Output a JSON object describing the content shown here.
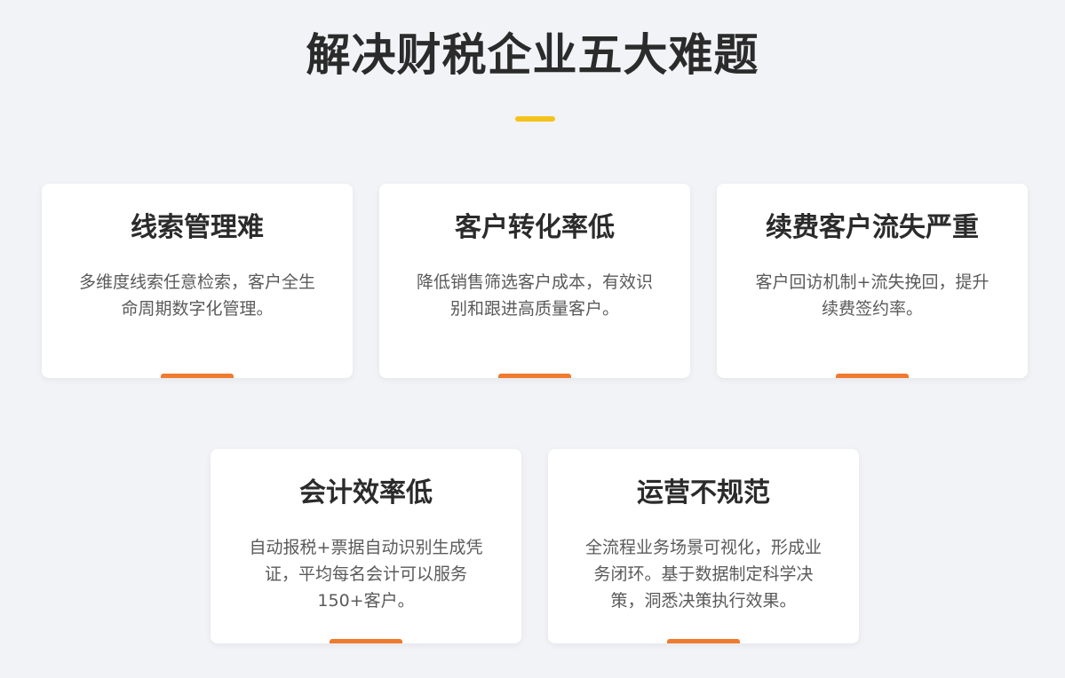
{
  "header": {
    "title": "解决财税企业五大难题"
  },
  "colors": {
    "title_bar": "#f5c21b",
    "card_accent": "#f07a2e"
  },
  "cards": [
    {
      "title": "线索管理难",
      "description": "多维度线索任意检索，客户全生命周期数字化管理。"
    },
    {
      "title": "客户转化率低",
      "description": "降低销售筛选客户成本，有效识别和跟进高质量客户。"
    },
    {
      "title": "续费客户流失严重",
      "description": "客户回访机制+流失挽回，提升续费签约率。"
    },
    {
      "title": "会计效率低",
      "description": "自动报税+票据自动识别生成凭证，平均每名会计可以服务150+客户。"
    },
    {
      "title": "运营不规范",
      "description": "全流程业务场景可视化，形成业务闭环。基于数据制定科学决策，洞悉决策执行效果。"
    }
  ]
}
